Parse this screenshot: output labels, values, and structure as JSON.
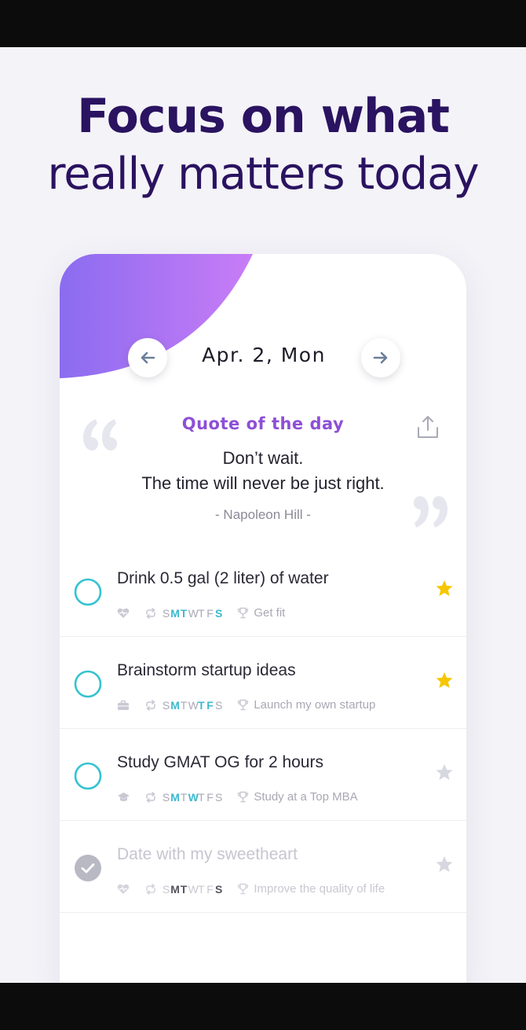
{
  "headline": {
    "line1": "Focus on what",
    "line2": "really matters today"
  },
  "header": {
    "date": "Apr. 2, Mon",
    "prev_icon": "arrow-left-icon",
    "next_icon": "arrow-right-icon"
  },
  "quote": {
    "title": "Quote of the day",
    "line1": "Don’t wait.",
    "line2": "The time will never be just right.",
    "author": "- Napoleon Hill -",
    "share_icon": "share-icon"
  },
  "days": [
    "S",
    "M",
    "T",
    "W",
    "T",
    "F",
    "S"
  ],
  "tasks": [
    {
      "title": "Drink 0.5 gal (2 liter) of water",
      "category_icon": "heart-icon",
      "goal": "Get fit",
      "active_days": [
        1,
        2,
        6
      ],
      "starred": true,
      "completed": false
    },
    {
      "title": "Brainstorm startup ideas",
      "category_icon": "briefcase-icon",
      "goal": "Launch my own startup",
      "active_days": [
        1,
        4,
        5
      ],
      "starred": true,
      "completed": false
    },
    {
      "title": "Study GMAT OG for 2 hours",
      "category_icon": "graduation-cap-icon",
      "goal": "Study at a Top MBA",
      "active_days": [
        1,
        3
      ],
      "starred": false,
      "completed": false
    },
    {
      "title": "Date with my sweetheart",
      "category_icon": "heart-icon",
      "goal": "Improve the quality of life",
      "active_days": [
        1,
        2,
        6
      ],
      "starred": false,
      "completed": true
    }
  ],
  "colors": {
    "headline": "#2a1360",
    "accent_purple": "#8e4fd6",
    "gradient_start": "#8b6cf0",
    "gradient_end": "#c77cf5",
    "check_teal": "#34c3cf",
    "star_gold": "#f7c600",
    "star_gray": "#d7d7e0"
  }
}
